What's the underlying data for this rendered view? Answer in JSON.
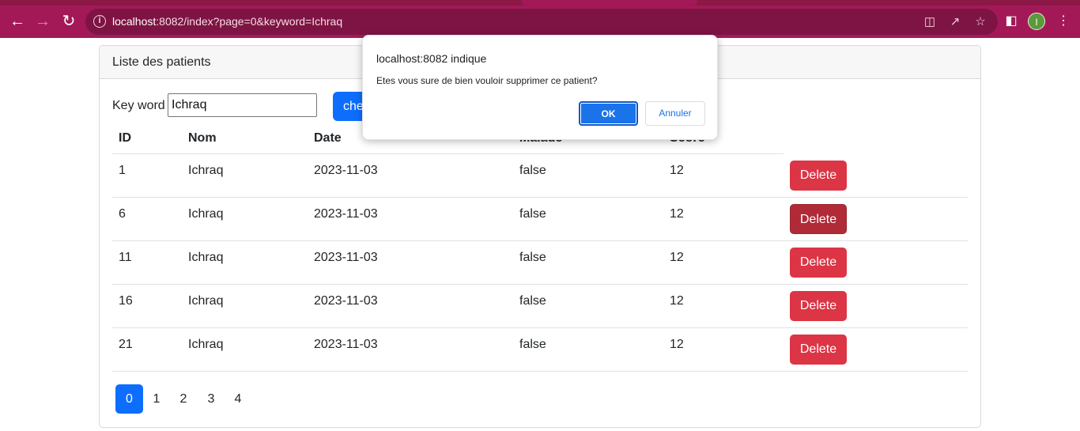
{
  "browser": {
    "url_host": "localhost",
    "url_rest": ":8082/index?page=0&keyword=Ichraq",
    "avatar_letter": "I",
    "theme_color": "#a31958"
  },
  "card": {
    "header": "Liste des patients"
  },
  "search": {
    "label": "Key word",
    "value": "Ichraq",
    "button_label": "chercher"
  },
  "table": {
    "columns": [
      "ID",
      "Nom",
      "Date",
      "Malade",
      "Score"
    ],
    "rows": [
      {
        "id": "1",
        "nom": "Ichraq",
        "date": "2023-11-03",
        "malade": "false",
        "score": "12",
        "action": "Delete"
      },
      {
        "id": "6",
        "nom": "Ichraq",
        "date": "2023-11-03",
        "malade": "false",
        "score": "12",
        "action": "Delete"
      },
      {
        "id": "11",
        "nom": "Ichraq",
        "date": "2023-11-03",
        "malade": "false",
        "score": "12",
        "action": "Delete"
      },
      {
        "id": "16",
        "nom": "Ichraq",
        "date": "2023-11-03",
        "malade": "false",
        "score": "12",
        "action": "Delete"
      },
      {
        "id": "21",
        "nom": "Ichraq",
        "date": "2023-11-03",
        "malade": "false",
        "score": "12",
        "action": "Delete"
      }
    ]
  },
  "pagination": {
    "pages": [
      "0",
      "1",
      "2",
      "3",
      "4"
    ],
    "active": "0"
  },
  "dialog": {
    "title": "localhost:8082 indique",
    "message": "Etes vous sure de bien vouloir supprimer ce patient?",
    "ok_label": "OK",
    "cancel_label": "Annuler"
  },
  "colors": {
    "primary": "#0d6efd",
    "danger": "#dc3545",
    "dialog_ok": "#1a73e8"
  }
}
